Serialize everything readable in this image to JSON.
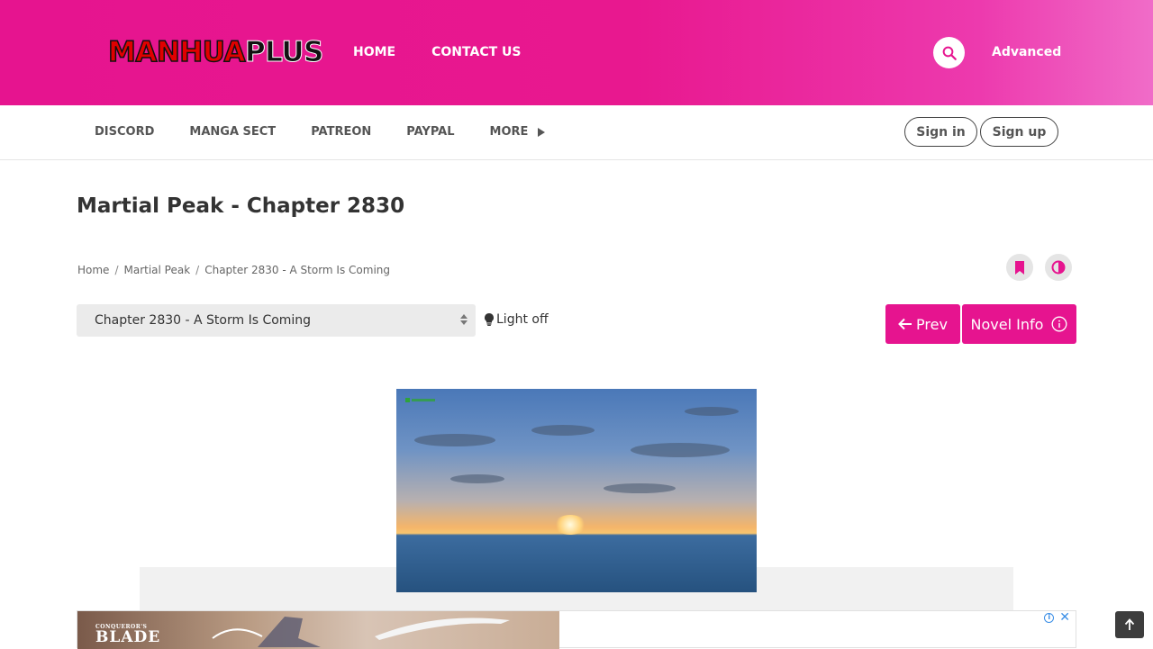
{
  "header": {
    "logo_part1": "MANHUA",
    "logo_part2": "PLUS",
    "nav": [
      "HOME",
      "CONTACT US"
    ],
    "advanced_label": "Advanced"
  },
  "subnav": {
    "items": [
      "DISCORD",
      "MANGA SECT",
      "PATREON",
      "PAYPAL"
    ],
    "more_label": "MORE",
    "signin_label": "Sign in",
    "signup_label": "Sign up"
  },
  "page": {
    "title": "Martial Peak - Chapter 2830",
    "breadcrumb": [
      "Home",
      "Martial Peak",
      "Chapter 2830 - A Storm Is Coming"
    ],
    "chapter_select_value": "Chapter 2830 - A Storm Is Coming",
    "light_off_label": "Light off",
    "prev_label": "Prev",
    "novel_info_label": "Novel Info"
  },
  "ads": {
    "banner_small": "CONQUEROR'S",
    "banner_title": "BLADE"
  },
  "colors": {
    "accent": "#e6148f",
    "header_gradient_end": "#f06cc8"
  },
  "icons": [
    "search-icon",
    "bookmark-icon",
    "contrast-icon",
    "lightbulb-icon",
    "arrow-left-icon",
    "info-icon",
    "adchoices-icon",
    "close-icon",
    "arrow-up-icon"
  ]
}
